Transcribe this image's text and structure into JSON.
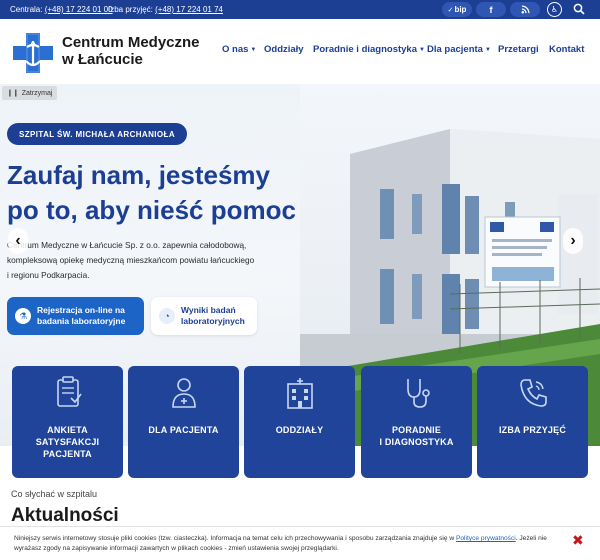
{
  "topbar": {
    "centrala_label": "Centrala:",
    "centrala_phone": "(+48) 17 224 01 00",
    "izba_label": "Izba przyjęć:",
    "izba_phone": "(+48) 17 224 01 74",
    "bip_label": "bip"
  },
  "header": {
    "brand_line1": "Centrum Medyczne",
    "brand_line2": "w Łańcucie",
    "nav": [
      {
        "label": "O nas",
        "has_dropdown": true
      },
      {
        "label": "Oddziały",
        "has_dropdown": false
      },
      {
        "label": "Poradnie i diagnostyka",
        "has_dropdown": true
      },
      {
        "label": "Dla pacjenta",
        "has_dropdown": true
      },
      {
        "label": "Przetargi",
        "has_dropdown": false
      },
      {
        "label": "Kontakt",
        "has_dropdown": false
      }
    ]
  },
  "hero": {
    "pause_label": "Zatrzymaj",
    "badge": "SZPITAL ŚW. MICHAŁA ARCHANIOŁA",
    "headline_line1": "Zaufaj nam, jesteśmy",
    "headline_line2": "po to, aby nieść pomoc",
    "desc_line1": "Centrum Medyczne w Łańcucie Sp. z o.o. zapewnia całodobową,",
    "desc_line2": "kompleksową opiekę medyczną mieszkańcom powiatu łańcuckiego",
    "desc_line3": "i regionu Podkarpacia.",
    "btn_reg_line1": "Rejestracja on-line na",
    "btn_reg_line2": "badania laboratoryjne",
    "btn_res_line1": "Wyniki badań",
    "btn_res_line2": "laboratoryjnych"
  },
  "tiles": [
    {
      "line1": "ANKIETA SATYSFAKCJI",
      "line2": "PACJENTA",
      "icon": "clipboard-icon"
    },
    {
      "line1": "DLA PACJENTA",
      "line2": "",
      "icon": "patient-icon"
    },
    {
      "line1": "ODDZIAŁY",
      "line2": "",
      "icon": "hospital-icon"
    },
    {
      "line1": "PORADNIE",
      "line2": "I DIAGNOSTYKA",
      "icon": "stethoscope-icon"
    },
    {
      "line1": "IZBA PRZYJĘĆ",
      "line2": "",
      "icon": "phone-icon"
    }
  ],
  "news": {
    "subtitle": "Co słychać w szpitalu",
    "title": "Aktualności"
  },
  "cookie": {
    "text_part1": "Niniejszy serwis internetowy stosuje pliki cookies (tzw. ciasteczka). Informacja na temat celu ich przechowywania i sposobu zarządzania znajduje się w ",
    "link": "Polityce prywatności",
    "text_part2": ". Jeżeli nie wyrażasz zgody na zapisywanie informacji zawartych w plikach cookies - zmień ustawienia swojej przeglądarki."
  },
  "colors": {
    "primary": "#1c3f94",
    "accent": "#1d64c7",
    "tile": "#1f449a",
    "close": "#c4161c"
  }
}
